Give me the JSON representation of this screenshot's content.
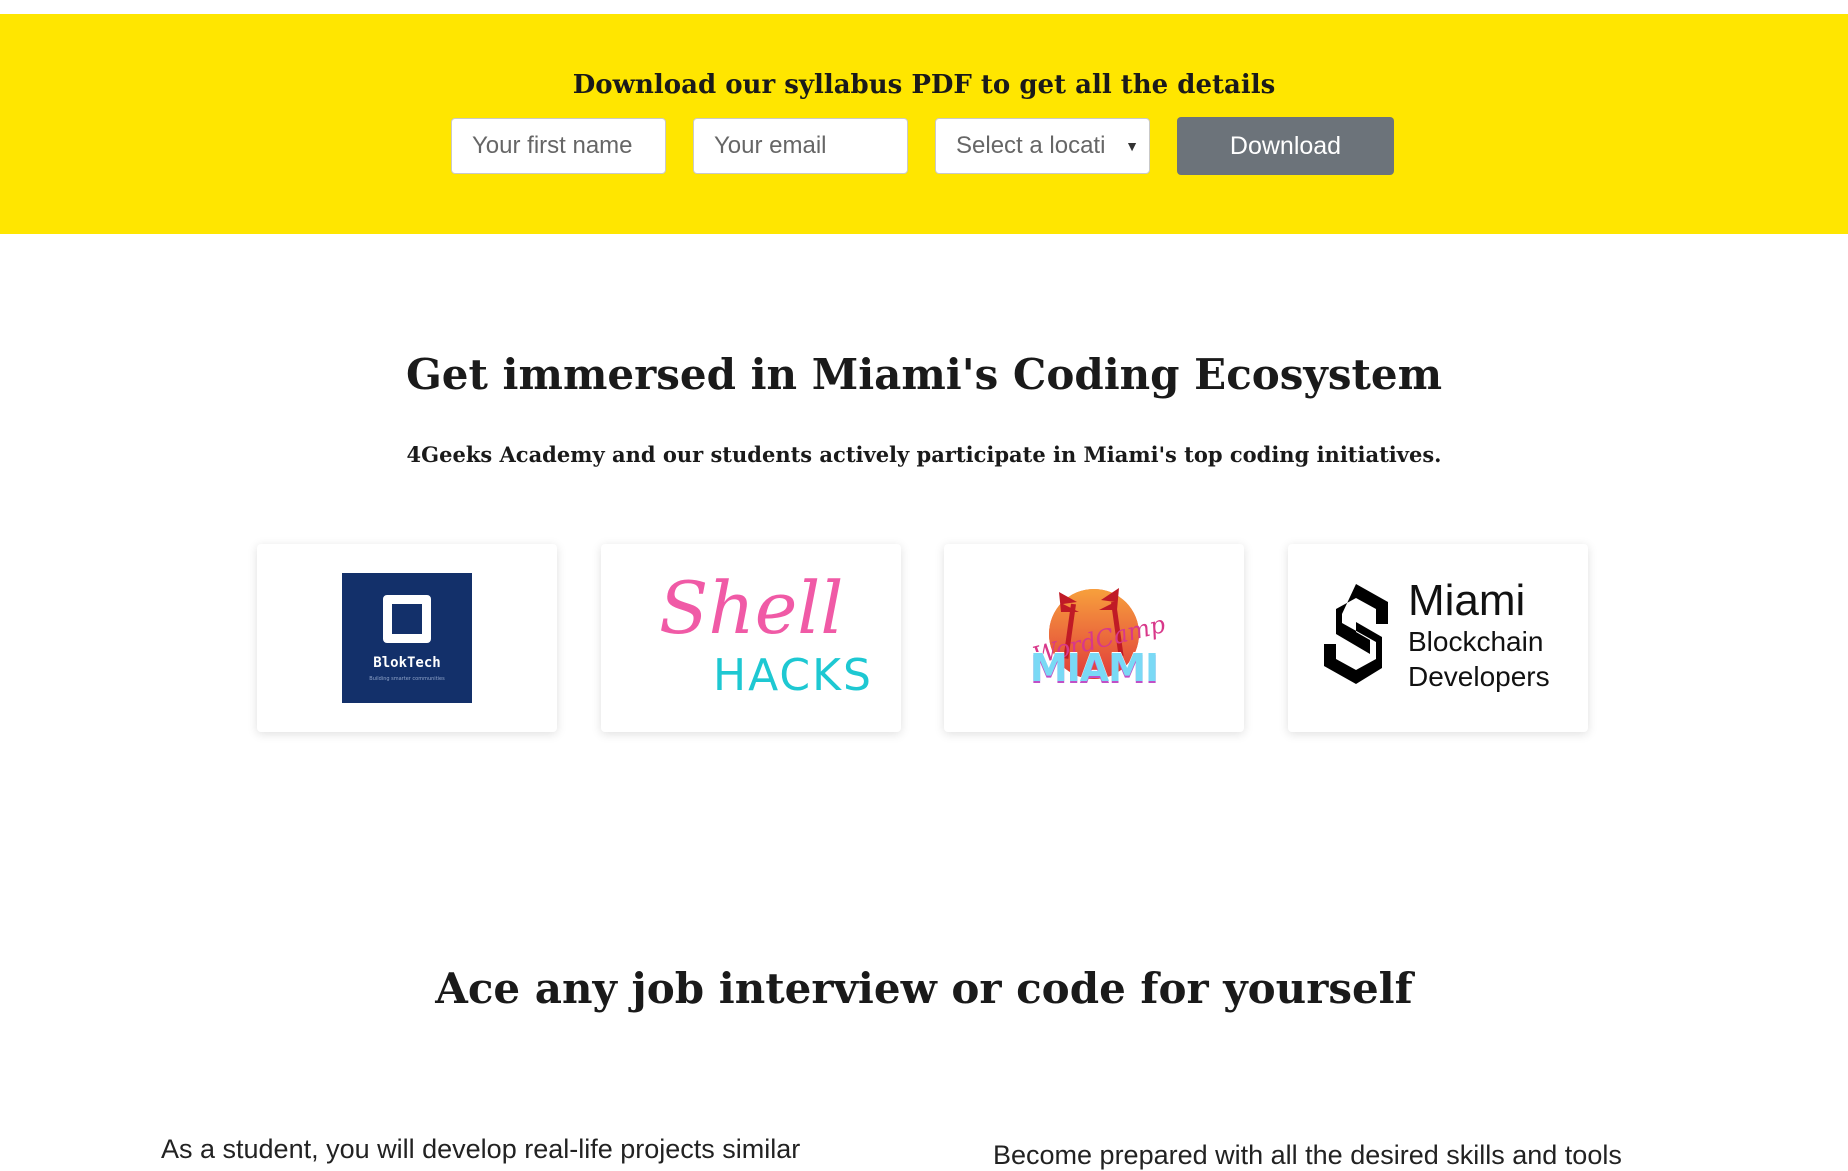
{
  "banner": {
    "title": "Download our syllabus PDF to get all the details",
    "first_name_placeholder": "Your first name",
    "email_placeholder": "Your email",
    "location_select": "Select a locati",
    "download_label": "Download",
    "bg_color": "#ffe600",
    "button_color": "#6c737a"
  },
  "ecosystem": {
    "title": "Get immersed in Miami's Coding Ecosystem",
    "subtitle": "4Geeks Academy and our students actively participate in Miami's top coding initiatives.",
    "partners": [
      {
        "name": "BlokTech",
        "tagline": "Building smarter communities"
      },
      {
        "line1": "Shell",
        "line2": "HACKS"
      },
      {
        "line1": "WordCamp",
        "line2": "MIAMI"
      },
      {
        "line1": "Miami",
        "line2": "Blockchain",
        "line3": "Developers"
      }
    ]
  },
  "interview": {
    "title": "Ace any job interview or code for yourself",
    "left_paragraph": "As a student, you will develop real-life projects similar",
    "right_paragraph": "Become prepared with all the desired skills and tools"
  }
}
